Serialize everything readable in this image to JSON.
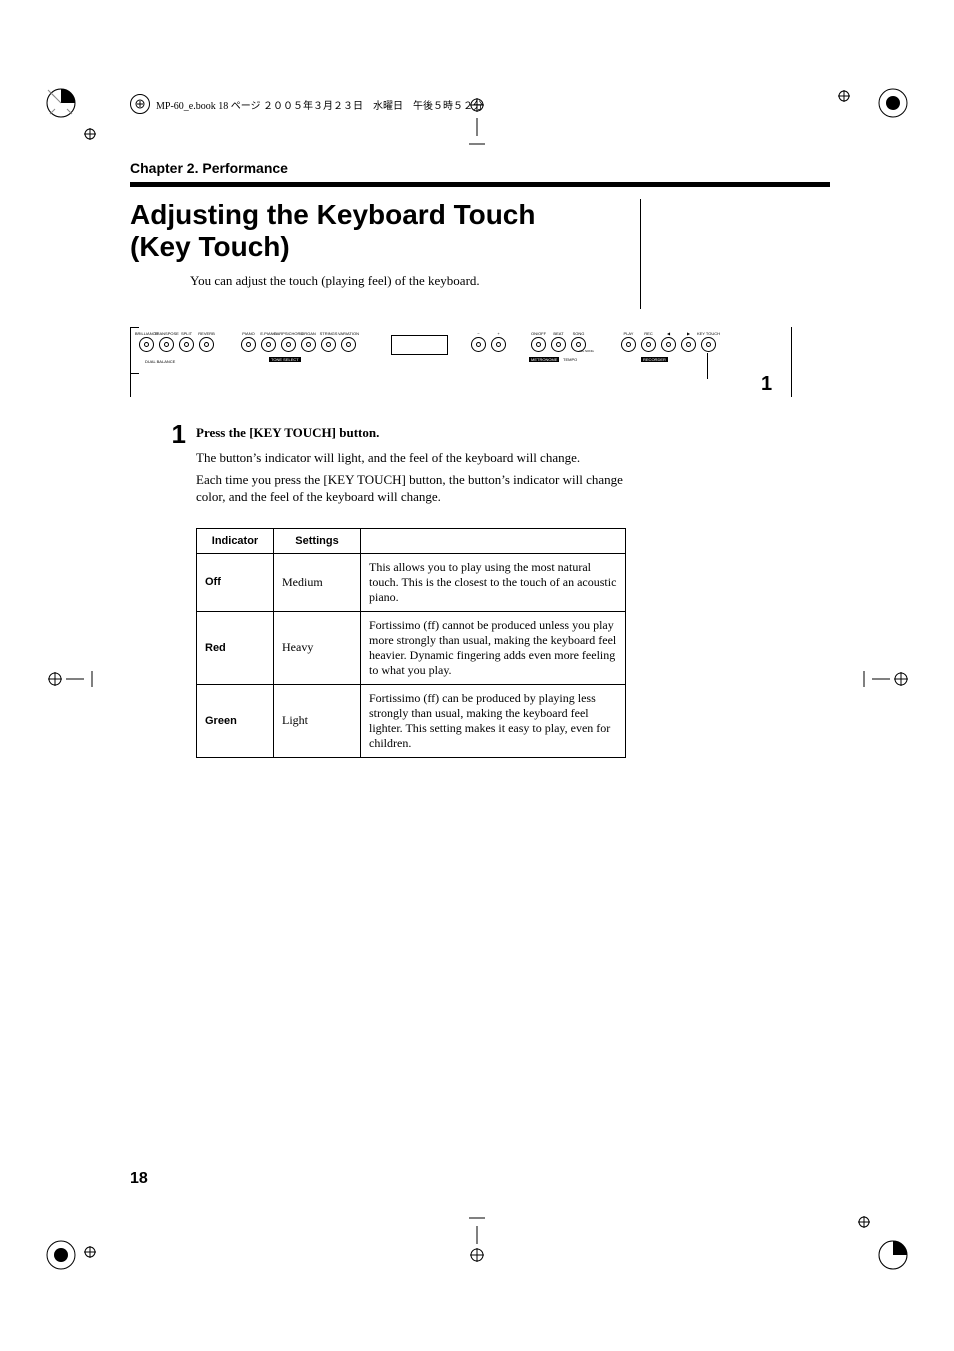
{
  "book_header": "MP-60_e.book 18 ページ ２００５年３月２３日　水曜日　午後５時５２分",
  "chapter_header": "Chapter 2. Performance",
  "title_line1": "Adjusting the Keyboard Touch",
  "title_line2": "(Key Touch)",
  "intro": "You can adjust the touch (playing feel) of the keyboard.",
  "panel": {
    "group1": [
      "BRILLIANCE",
      "TRANSPOSE",
      "SPLIT",
      "REVERB"
    ],
    "group1_under": "DUAL BALANCE",
    "group2": [
      "PIANO",
      "E.PIANO",
      "HARPSICHORD",
      "ORGAN",
      "STRINGS",
      "VARIATION"
    ],
    "group2_under": "TONE SELECT",
    "minus": "−",
    "plus": "+",
    "group3": [
      "ON/OFF",
      "BEAT",
      "SONG"
    ],
    "group3_under_a": "METRONOME",
    "group3_under_b": "TEMPO",
    "group3_under_c": "ALL SONG",
    "group4": [
      "PLAY",
      "REC",
      "◀",
      "▶",
      "KEY TOUCH"
    ],
    "group4_under": "RECORDER",
    "callout": "1"
  },
  "step": {
    "number": "1",
    "title": "Press the [KEY TOUCH] button.",
    "p1": "The button’s indicator will light, and the feel of the keyboard will change.",
    "p2": "Each time you press the [KEY TOUCH] button, the button’s indicator will change color, and the feel of the keyboard will change."
  },
  "table": {
    "headers": [
      "Indicator",
      "Settings"
    ],
    "rows": [
      {
        "indicator": "Off",
        "setting": "Medium",
        "desc": "This allows you to play using the most natural touch. This is the closest to the touch of an acoustic piano."
      },
      {
        "indicator": "Red",
        "setting": "Heavy",
        "desc": "Fortissimo (ff) cannot be produced unless you play more strongly than usual, making the keyboard feel heavier. Dynamic fingering adds even more feeling to what you play."
      },
      {
        "indicator": "Green",
        "setting": "Light",
        "desc": "Fortissimo (ff) can be produced by playing less strongly than usual, making the keyboard feel lighter. This setting makes it easy to play, even for children."
      }
    ]
  },
  "page_number": "18"
}
